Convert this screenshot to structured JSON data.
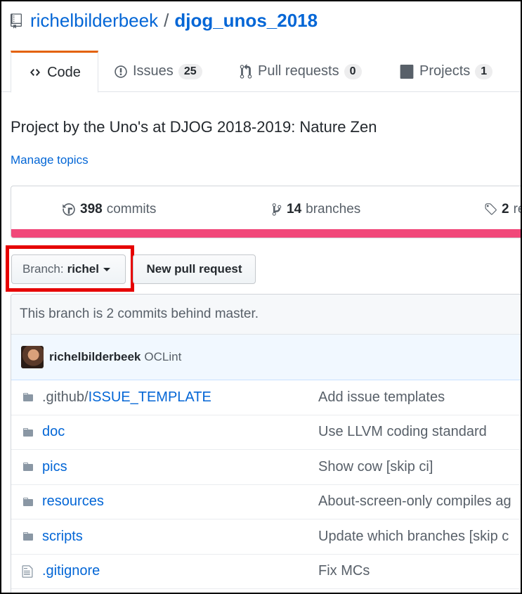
{
  "repo": {
    "owner": "richelbilderbeek",
    "separator": "/",
    "name": "djog_unos_2018",
    "icon": "repo-icon"
  },
  "tabs": [
    {
      "label": "Code",
      "icon": "code-icon",
      "selected": true
    },
    {
      "label": "Issues",
      "count": "25",
      "icon": "issue-opened-icon"
    },
    {
      "label": "Pull requests",
      "count": "0",
      "icon": "git-pull-request-icon"
    },
    {
      "label": "Projects",
      "count": "1",
      "icon": "project-icon"
    }
  ],
  "description": "Project by the Uno's at DJOG 2018-2019: Nature Zen",
  "manage_topics": "Manage topics",
  "summary": {
    "commits_count": "398",
    "commits_label": "commits",
    "branches_count": "14",
    "branches_label": "branches",
    "releases_count": "2",
    "releases_label": "releases",
    "language_bar_color": "#f1487a"
  },
  "branch_select": {
    "prefix": "Branch:",
    "value": "richel"
  },
  "new_pr_label": "New pull request",
  "branch_status": "This branch is 2 commits behind master.",
  "latest_commit": {
    "author": "richelbilderbeek",
    "message": "OCLint"
  },
  "files": [
    {
      "type": "directory",
      "prefix": ".github/",
      "name": "ISSUE_TEMPLATE",
      "message": "Add issue templates"
    },
    {
      "type": "directory",
      "prefix": "",
      "name": "doc",
      "message": "Use LLVM coding standard"
    },
    {
      "type": "directory",
      "prefix": "",
      "name": "pics",
      "message": "Show cow [skip ci]"
    },
    {
      "type": "directory",
      "prefix": "",
      "name": "resources",
      "message": "About-screen-only compiles ag"
    },
    {
      "type": "directory",
      "prefix": "",
      "name": "scripts",
      "message": "Update which branches [skip c"
    },
    {
      "type": "file",
      "prefix": "",
      "name": ".gitignore",
      "message": "Fix MCs"
    }
  ],
  "colors": {
    "link": "#0366d6",
    "tab_accent": "#e36209",
    "highlight_box": "#e60000"
  }
}
